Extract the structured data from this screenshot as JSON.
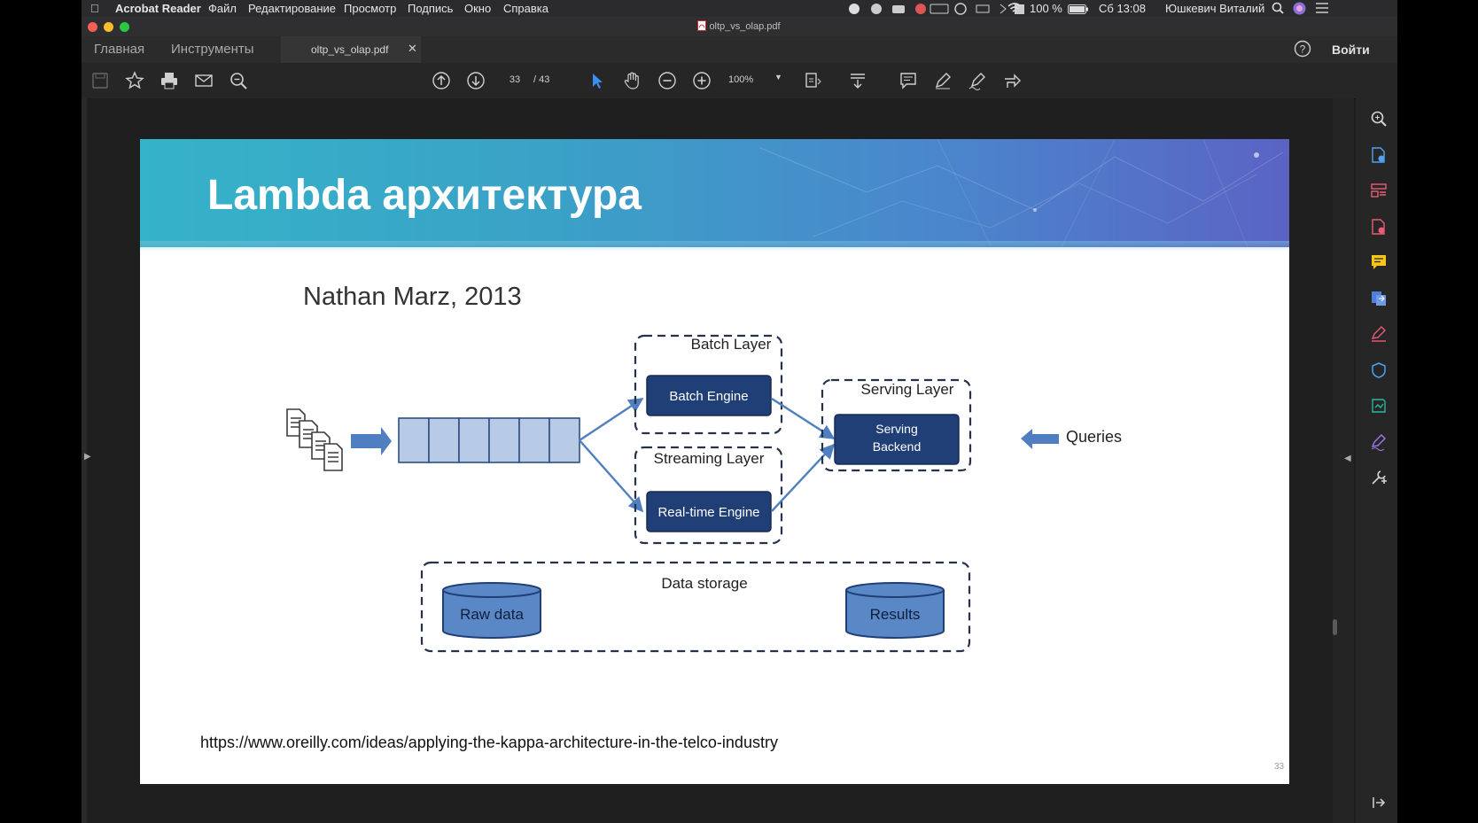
{
  "menubar": {
    "app_name": "Acrobat Reader",
    "items": [
      "Файл",
      "Редактирование",
      "Просмотр",
      "Подпись",
      "Окно",
      "Справка"
    ],
    "battery": "100 %",
    "clock": "Сб 13:08",
    "user": "Юшкевич Виталий"
  },
  "window": {
    "title": "oltp_vs_olap.pdf"
  },
  "tabs": {
    "home": "Главная",
    "tools": "Инструменты",
    "document": "oltp_vs_olap.pdf",
    "signin": "Войти"
  },
  "toolbar": {
    "page_current": "33",
    "page_total": "/ 43",
    "zoom": "100%"
  },
  "slide": {
    "title": "Lambda архитектура",
    "subtitle": "Nathan Marz, 2013",
    "url": "https://www.oreilly.com/ideas/applying-the-kappa-architecture-in-the-telco-industry",
    "page_number": "33",
    "diagram": {
      "batch_layer": "Batch Layer",
      "batch_engine": "Batch Engine",
      "streaming_layer": "Streaming Layer",
      "realtime_engine": "Real-time Engine",
      "serving_layer": "Serving Layer",
      "serving_backend_line1": "Serving",
      "serving_backend_line2": "Backend",
      "queries": "Queries",
      "data_storage": "Data storage",
      "raw_data": "Raw data",
      "results": "Results"
    }
  },
  "colors": {
    "engine_fill": "#1f3f76",
    "queue_fill": "#b7cbe6",
    "cylinder_fill": "#5a87c6",
    "arrow": "#4f7fc0",
    "header_start": "#35b3c8",
    "header_end": "#5b63c4"
  },
  "icons": {
    "toolbar": [
      "save-icon",
      "bookmark-star-icon",
      "print-icon",
      "email-icon",
      "find-icon",
      "prev-page-icon",
      "next-page-icon",
      "select-cursor-icon",
      "hand-icon",
      "zoom-out-icon",
      "zoom-in-icon",
      "page-fit-icon",
      "scroll-mode-icon",
      "comment-icon",
      "highlight-pen-icon",
      "sign-icon",
      "share-icon"
    ],
    "sidebar": [
      "search-icon",
      "export-pdf-icon",
      "organize-pages-icon",
      "create-pdf-icon",
      "comment-icon",
      "send-icon",
      "fill-sign-icon",
      "protect-icon",
      "enhance-scan-icon",
      "sign-icon",
      "more-tools-icon"
    ]
  }
}
